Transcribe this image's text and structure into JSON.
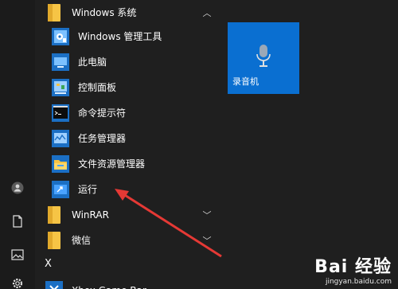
{
  "colors": {
    "accent": "#0a6fd1",
    "folder": "#f6c445",
    "arrow": "#e53935"
  },
  "group": {
    "title": "Windows 系统"
  },
  "items": [
    {
      "label": "Windows 管理工具",
      "icon": "admin-tools-icon"
    },
    {
      "label": "此电脑",
      "icon": "this-pc-icon"
    },
    {
      "label": "控制面板",
      "icon": "control-panel-icon"
    },
    {
      "label": "命令提示符",
      "icon": "command-prompt-icon"
    },
    {
      "label": "任务管理器",
      "icon": "task-manager-icon"
    },
    {
      "label": "文件资源管理器",
      "icon": "file-explorer-icon"
    },
    {
      "label": "运行",
      "icon": "run-icon"
    }
  ],
  "folders": [
    {
      "label": "WinRAR"
    },
    {
      "label": "微信"
    }
  ],
  "section_letter": "X",
  "next_item": "Xbox Game Bar",
  "tile": {
    "label": "录音机",
    "icon": "microphone-icon"
  },
  "watermark": {
    "brand": "Bai 经验",
    "url": "jingyan.baidu.com"
  }
}
